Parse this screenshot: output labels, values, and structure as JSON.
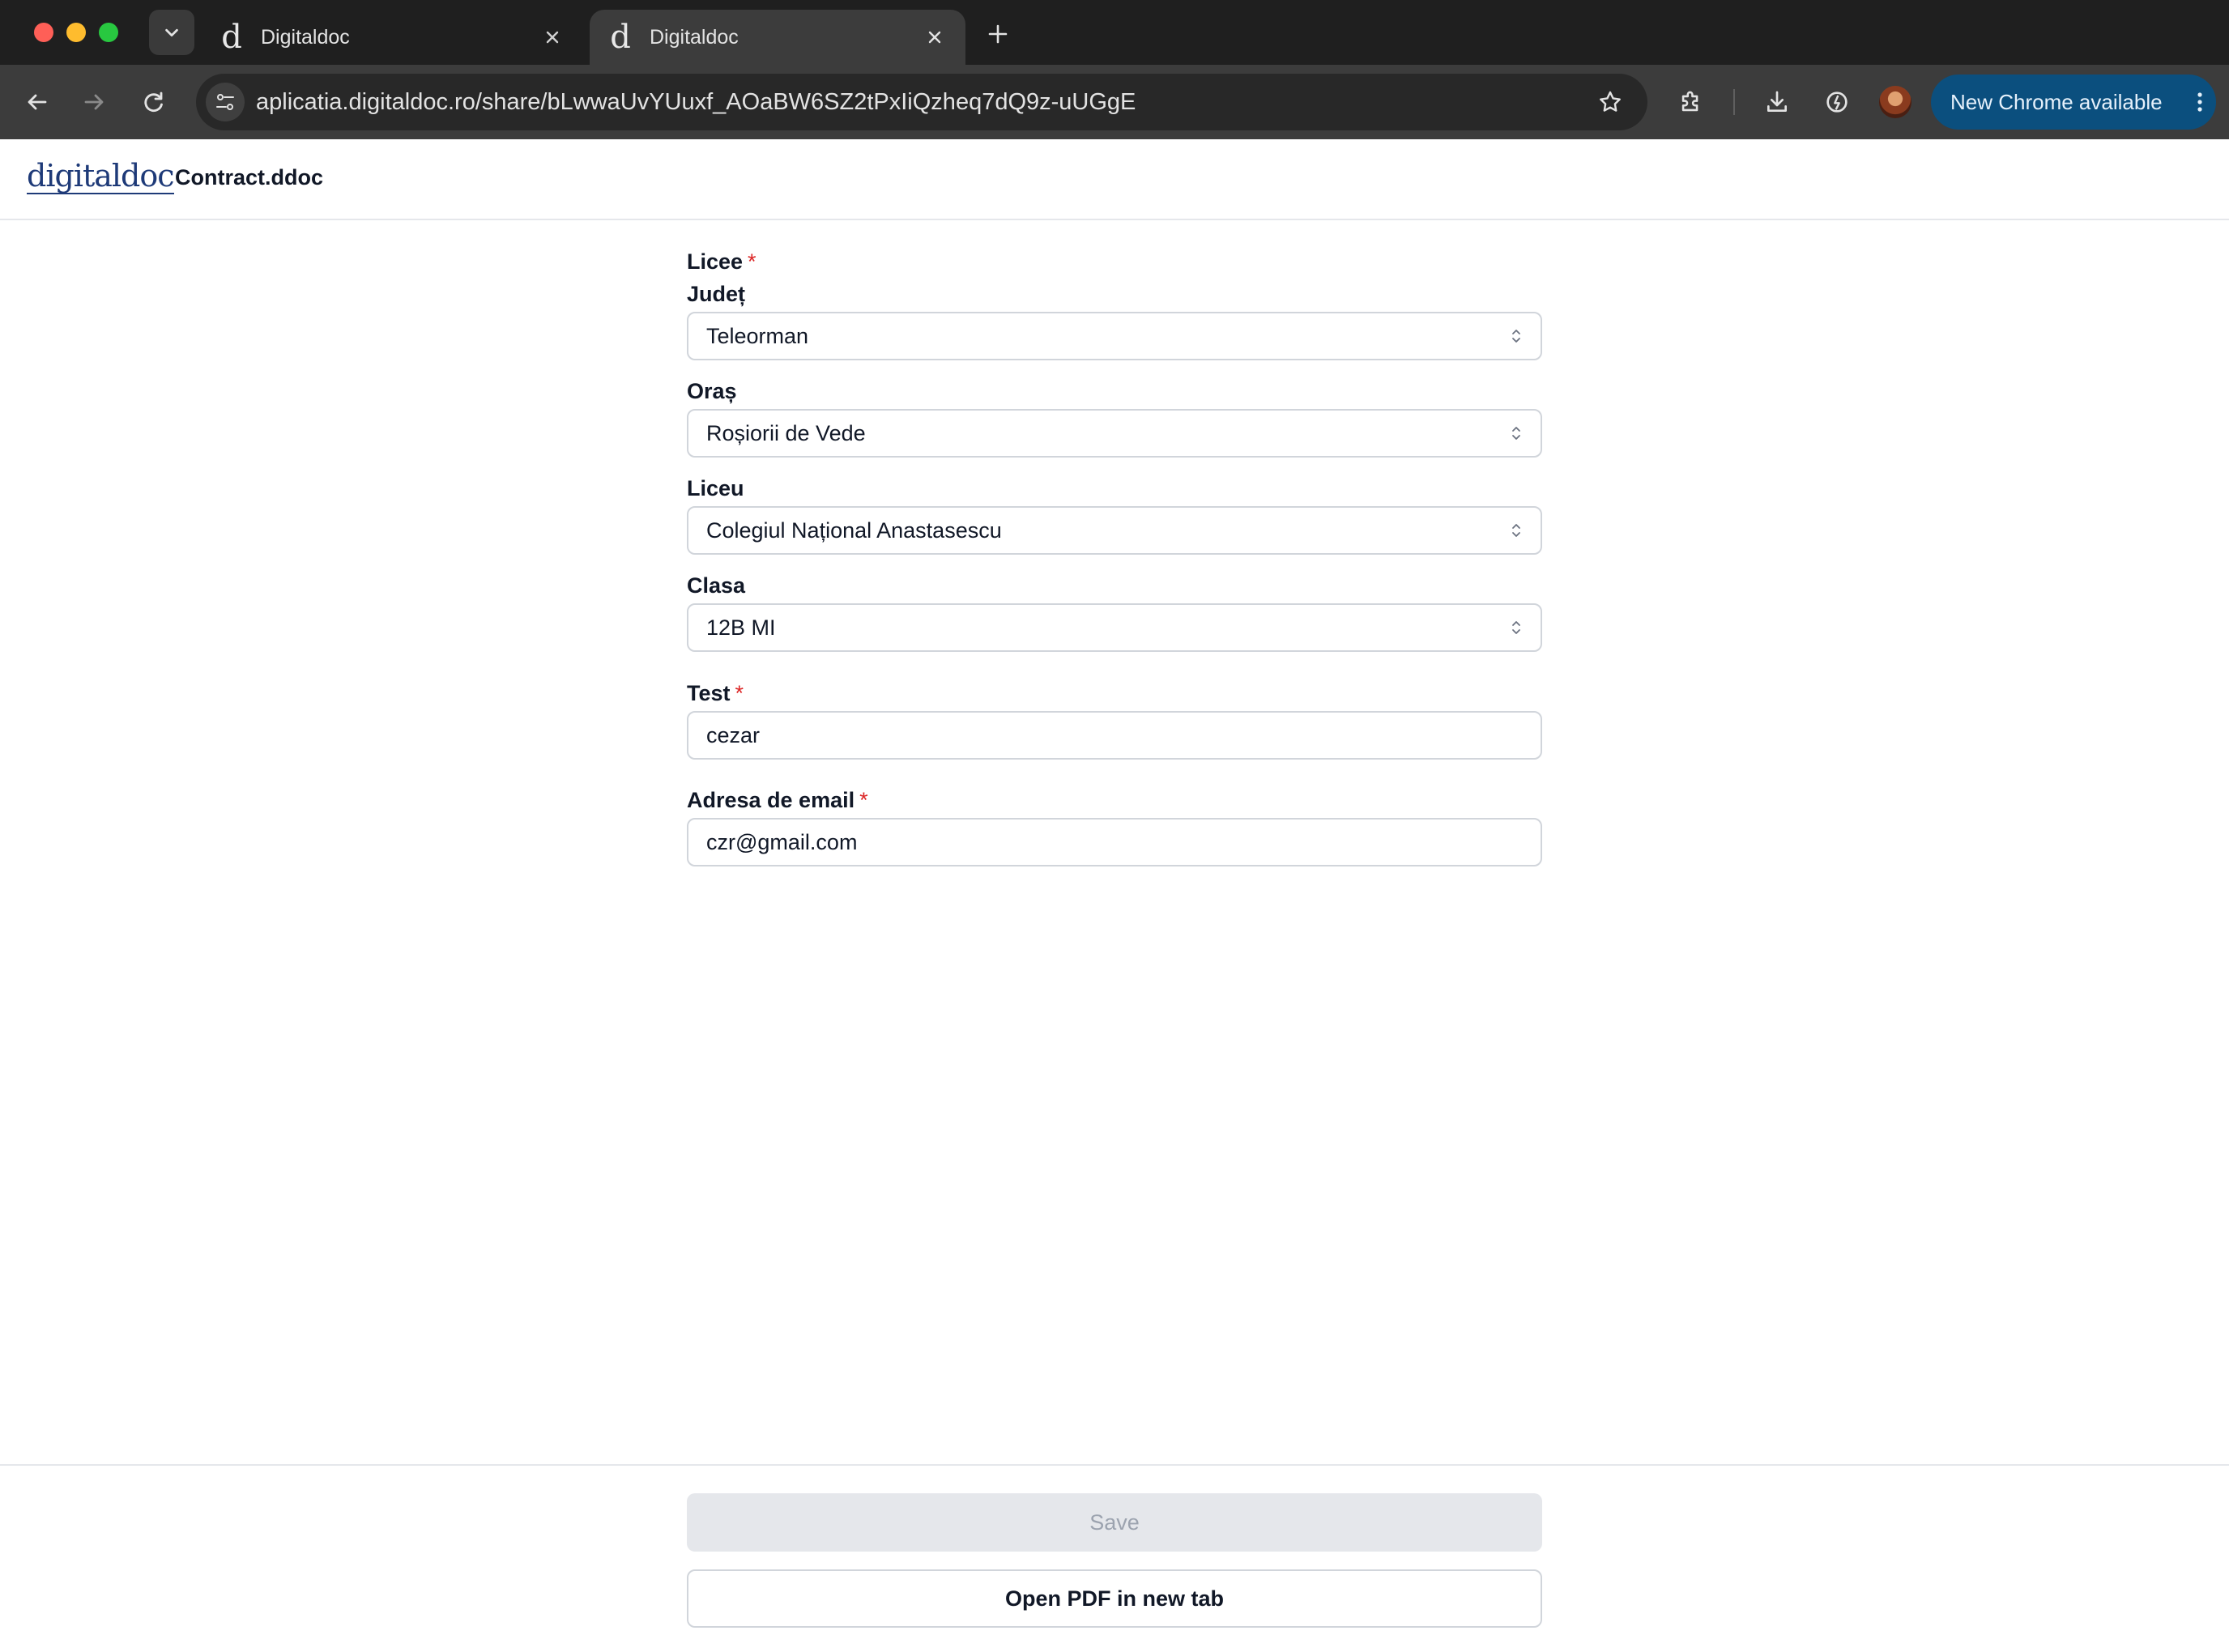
{
  "browser": {
    "tabs": [
      {
        "favicon": "d",
        "title": "Digitaldoc",
        "active": false
      },
      {
        "favicon": "d",
        "title": "Digitaldoc",
        "active": true
      }
    ],
    "url": "aplicatia.digitaldoc.ro/share/bLwwaUvYUuxf_AOaBW6SZ2tPxIiQzheq7dQ9z-uUGgE",
    "update_label": "New Chrome available",
    "icons": [
      "tab-search-icon",
      "close-icon",
      "new-tab-icon",
      "back-icon",
      "forward-icon",
      "reload-icon",
      "site-settings-icon",
      "bookmark-star-icon",
      "extensions-icon",
      "downloads-icon",
      "performance-icon",
      "profile-avatar",
      "more-vert-icon"
    ],
    "colors": {
      "update_button": "#0b4f7e",
      "toolbar": "#3c3c3c",
      "tabstrip": "#1f1f1f"
    }
  },
  "app": {
    "logo": "digitaldoc",
    "document_name": "Contract.ddoc"
  },
  "form": {
    "group_title": "Licee",
    "required_marker": "*",
    "county": {
      "label": "Județ",
      "value": "Teleorman"
    },
    "city": {
      "label": "Oraș",
      "value": "Roșiorii de Vede"
    },
    "school": {
      "label": "Liceu",
      "value": "Colegiul Național Anastasescu"
    },
    "class": {
      "label": "Clasa",
      "value": "12B MI"
    },
    "test": {
      "label": "Test",
      "value": "cezar"
    },
    "email": {
      "label": "Adresa de email",
      "value": "czr@gmail.com"
    }
  },
  "footer": {
    "save_label": "Save",
    "save_disabled": true,
    "open_pdf_label": "Open PDF in new tab"
  }
}
